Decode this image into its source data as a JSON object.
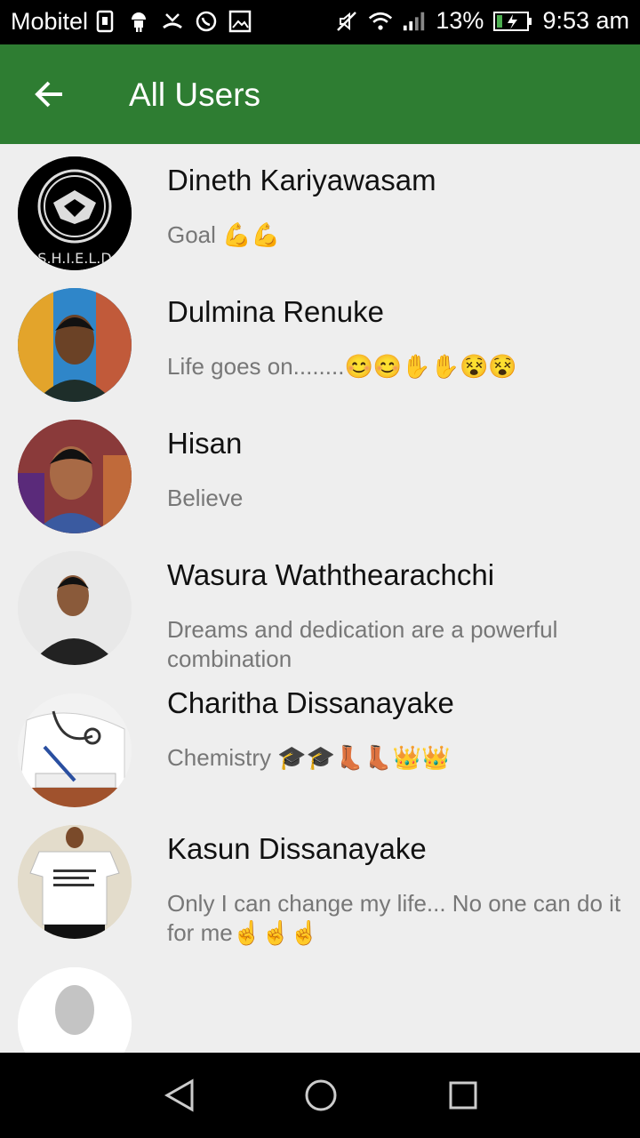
{
  "status_bar": {
    "carrier": "Mobitel",
    "battery_percent": "13%",
    "time": "9:53 am"
  },
  "app_bar": {
    "title": "All Users"
  },
  "users": [
    {
      "name": "Dineth Kariyawasam",
      "status": "Goal 💪💪",
      "avatar": "shield-logo"
    },
    {
      "name": "Dulmina Renuke",
      "status": "Life goes on........😊😊✋✋😵😵",
      "avatar": "photo"
    },
    {
      "name": "Hisan",
      "status": "Believe",
      "avatar": "photo"
    },
    {
      "name": "Wasura Waththearachchi",
      "status": "Dreams and dedication are a powerful combination",
      "avatar": "photo"
    },
    {
      "name": "Charitha Dissanayake",
      "status": "Chemistry 🎓🎓👢👢👑👑",
      "avatar": "photo"
    },
    {
      "name": "Kasun Dissanayake",
      "status": "Only I can change my life... No one can do it for me☝☝☝",
      "avatar": "photo"
    },
    {
      "name": "",
      "status": "",
      "avatar": "default-silhouette"
    }
  ],
  "colors": {
    "primary": "#2e7d32",
    "list_bg": "#eeeeee",
    "name_text": "#111111",
    "status_text": "#777777"
  }
}
